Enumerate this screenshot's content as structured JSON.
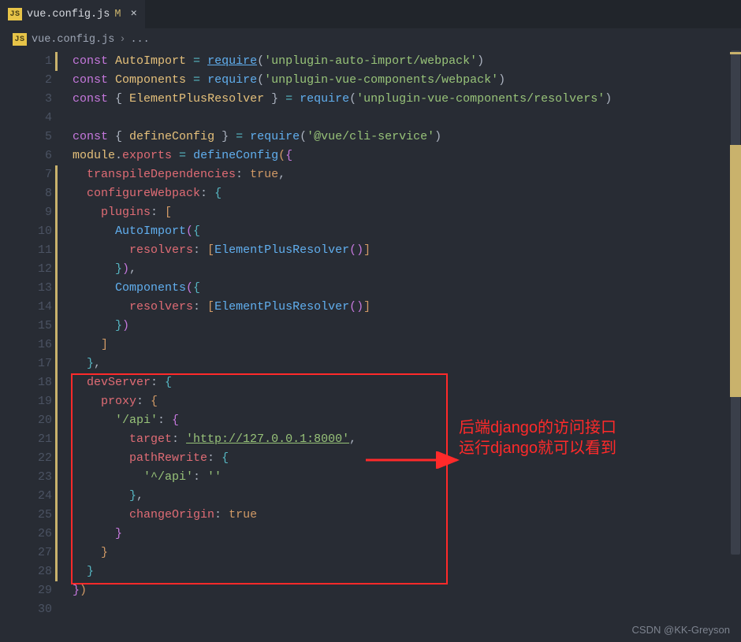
{
  "tabBar": {
    "tabs": [
      {
        "icon": "JS",
        "label": "vue.config.js",
        "modified": "M"
      }
    ]
  },
  "breadcrumb": {
    "icon": "JS",
    "file": "vue.config.js",
    "chevron": "›",
    "rest": "..."
  },
  "gutter": {
    "start": 1,
    "end": 30
  },
  "annotation": {
    "line1": "后端django的访问接口",
    "line2": "运行django就可以看到"
  },
  "code": {
    "kw_const": "const",
    "var_AutoImport": "AutoImport",
    "var_Components": "Components",
    "var_ElementPlusResolver": "ElementPlusResolver",
    "var_defineConfig": "defineConfig",
    "fn_require": "require",
    "fn_defineConfig": "defineConfig",
    "op_eq": " = ",
    "prop_module": "module",
    "prop_exports": "exports",
    "prop_transpile": "transpileDependencies",
    "prop_configureWebpack": "configureWebpack",
    "prop_plugins": "plugins",
    "prop_resolvers": "resolvers",
    "prop_devServer": "devServer",
    "prop_proxy": "proxy",
    "prop_target": "target",
    "prop_pathRewrite": "pathRewrite",
    "prop_changeOrigin": "changeOrigin",
    "bool_true": "true",
    "str_autoImport": "'unplugin-auto-import/webpack'",
    "str_vueComponents": "'unplugin-vue-components/webpack'",
    "str_resolvers": "'unplugin-vue-components/resolvers'",
    "str_cliService": "'@vue/cli-service'",
    "str_api": "'/api'",
    "str_target": "'http://127.0.0.1:8000'",
    "str_caretApi": "'^/api'",
    "str_empty": "''"
  },
  "watermark": "CSDN @KK-Greyson"
}
